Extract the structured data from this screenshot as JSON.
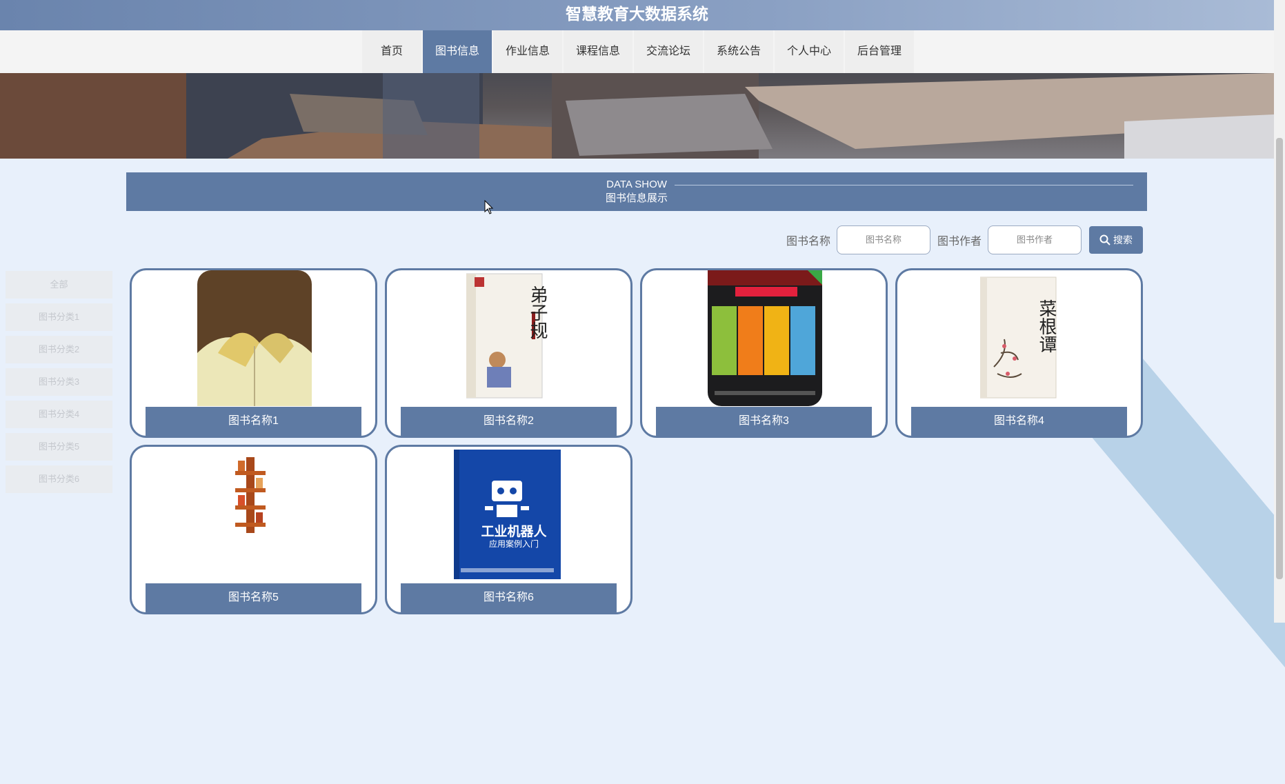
{
  "header": {
    "title": "智慧教育大数据系统"
  },
  "nav": {
    "items": [
      {
        "label": "首页"
      },
      {
        "label": "图书信息"
      },
      {
        "label": "作业信息"
      },
      {
        "label": "课程信息"
      },
      {
        "label": "交流论坛"
      },
      {
        "label": "系统公告"
      },
      {
        "label": "个人中心"
      },
      {
        "label": "后台管理"
      }
    ],
    "active": "图书信息"
  },
  "section": {
    "title_en": "DATA SHOW",
    "title_cn": "图书信息展示"
  },
  "search": {
    "name_label": "图书名称",
    "name_placeholder": "图书名称",
    "author_label": "图书作者",
    "author_placeholder": "图书作者",
    "button_label": "搜索"
  },
  "categories": [
    {
      "label": "全部"
    },
    {
      "label": "图书分类1"
    },
    {
      "label": "图书分类2"
    },
    {
      "label": "图书分类3"
    },
    {
      "label": "图书分类4"
    },
    {
      "label": "图书分类5"
    },
    {
      "label": "图书分类6"
    }
  ],
  "books": [
    {
      "name": "图书名称1"
    },
    {
      "name": "图书名称2",
      "cover_text": "弟子规"
    },
    {
      "name": "图书名称3"
    },
    {
      "name": "图书名称4",
      "cover_text": "菜根谭"
    },
    {
      "name": "图书名称5"
    },
    {
      "name": "图书名称6",
      "cover_text": "工业机器人",
      "cover_subtext": "应用案例入门"
    }
  ],
  "colors": {
    "accent": "#5e7aa3",
    "page_bg": "#e8f0fb"
  }
}
